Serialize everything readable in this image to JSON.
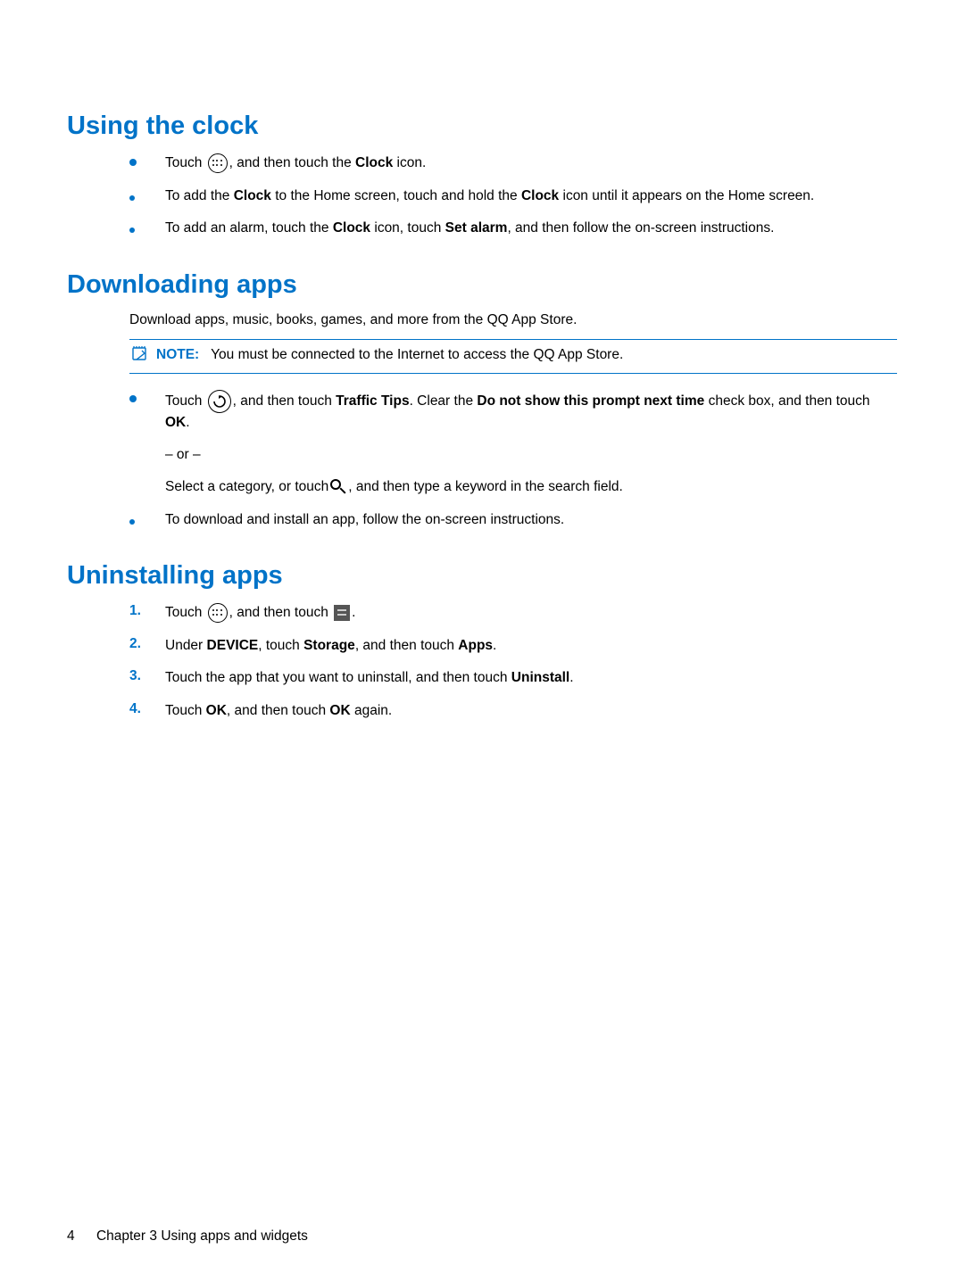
{
  "headings": {
    "clock": "Using the clock",
    "download": "Downloading apps",
    "uninstall": "Uninstalling apps"
  },
  "clock": {
    "item1": {
      "pre": "Touch ",
      "post": ", and then touch the ",
      "bold1": "Clock",
      "tail": " icon."
    },
    "item2": {
      "pre": "To add the ",
      "b1": "Clock",
      "mid": " to the Home screen, touch and hold the ",
      "b2": "Clock",
      "tail": " icon until it appears on the Home screen."
    },
    "item3": {
      "pre": "To add an alarm, touch the ",
      "b1": "Clock",
      "mid": " icon, touch ",
      "b2": "Set alarm",
      "tail": ", and then follow the on-screen instructions."
    }
  },
  "download": {
    "intro": "Download apps, music, books, games, and more from the QQ App Store.",
    "note_label": "NOTE:",
    "note_text": "You must be connected to the Internet to access the QQ App Store.",
    "item1": {
      "p1_pre": "Touch ",
      "p1_mid": ", and then touch ",
      "p1_b1": "Traffic Tips",
      "p1_mid2": ". Clear the ",
      "p1_b2": "Do not show this prompt next time",
      "p1_mid3": " check box, and then touch ",
      "p1_b3": "OK",
      "p1_tail": ".",
      "or": "– or –",
      "p2_pre": "Select a category, or touch",
      "p2_post": ", and then type a keyword in the search field."
    },
    "item2": "To download and install an app, follow the on-screen instructions."
  },
  "uninstall": {
    "step1": {
      "num": "1.",
      "pre": "Touch ",
      "mid": ", and then touch ",
      "tail": "."
    },
    "step2": {
      "num": "2.",
      "pre": "Under ",
      "b1": "DEVICE",
      "mid": ", touch ",
      "b2": "Storage",
      "mid2": ", and then touch ",
      "b3": "Apps",
      "tail": "."
    },
    "step3": {
      "num": "3.",
      "pre": "Touch the app that you want to uninstall, and then touch ",
      "b1": "Uninstall",
      "tail": "."
    },
    "step4": {
      "num": "4.",
      "pre": "Touch ",
      "b1": "OK",
      "mid": ", and then touch ",
      "b2": "OK",
      "tail": " again."
    }
  },
  "footer": {
    "page_number": "4",
    "chapter": "Chapter 3   Using apps and widgets"
  }
}
